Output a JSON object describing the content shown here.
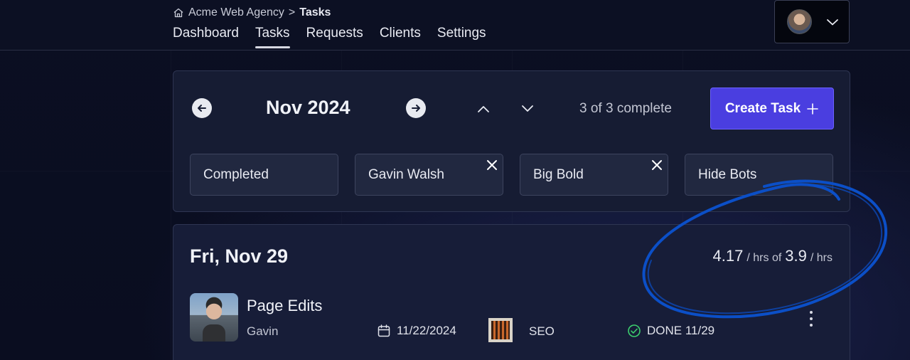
{
  "header": {
    "breadcrumb": {
      "org": "Acme Web Agency",
      "separator": ">",
      "current": "Tasks"
    },
    "nav": [
      {
        "label": "Dashboard",
        "active": false
      },
      {
        "label": "Tasks",
        "active": true
      },
      {
        "label": "Requests",
        "active": false
      },
      {
        "label": "Clients",
        "active": false
      },
      {
        "label": "Settings",
        "active": false
      }
    ]
  },
  "toolbar": {
    "month": "Nov 2024",
    "complete_status": "3 of 3 complete",
    "create_label": "Create Task",
    "create_icon": "plus-icon"
  },
  "filters": [
    {
      "label": "Completed",
      "clearable": false
    },
    {
      "label": "Gavin Walsh",
      "clearable": true
    },
    {
      "label": "Big Bold",
      "clearable": true
    },
    {
      "label": "Hide Bots",
      "clearable": false
    }
  ],
  "day": {
    "title": "Fri, Nov 29",
    "hours_logged": "4.17",
    "hours_unit": "/ hrs of",
    "hours_estimated": "3.9",
    "hours_unit2": "/ hrs",
    "tasks": [
      {
        "title": "Page Edits",
        "assignee": "Gavin",
        "due_date": "11/22/2024",
        "type": "SEO",
        "status": "DONE 11/29"
      }
    ]
  },
  "colors": {
    "accent": "#4a3ee0",
    "status_done": "#3ccf6e",
    "annotation": "#0b4fc7"
  }
}
